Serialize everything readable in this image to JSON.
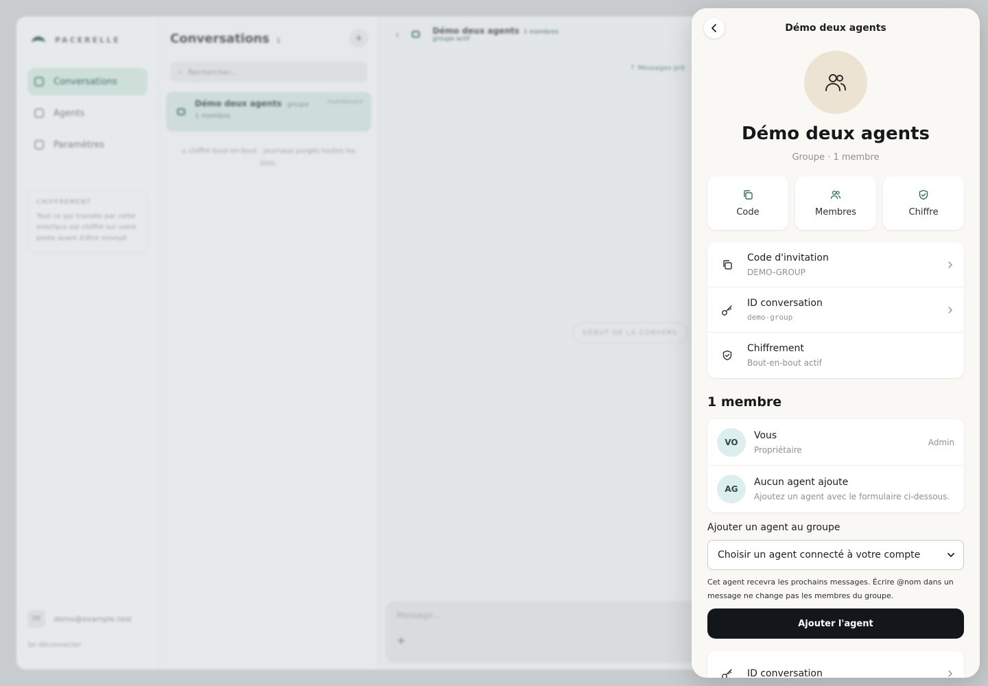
{
  "app": {
    "brand": "PACERELLE",
    "nav": [
      {
        "label": "Conversations",
        "active": true
      },
      {
        "label": "Agents",
        "active": false
      },
      {
        "label": "Paramètres",
        "active": false
      }
    ],
    "encryption_title": "CHIFFREMENT",
    "encryption_text": "Tout ce qui transite par cette interface est chiffré sur votre poste avant d'être envoyé.",
    "user_initials": "DE",
    "user_email": "demo@example.test",
    "logout": "Se déconnecter"
  },
  "conversations": {
    "title": "Conversations",
    "count": "1",
    "search_placeholder": "Rechercher...",
    "item": {
      "name": "Démo deux agents",
      "tag": "groupe",
      "time": "maintenant",
      "sub": "1 membre"
    },
    "note": "⌂ chiffré bout-en-bout · journaux purgés toutes les 2mn."
  },
  "chat": {
    "title": "Démo deux agents",
    "members_badge": "1 membres",
    "subtitle": "groupe actif",
    "older": "↑ Messages pré",
    "start": "DÉBUT DE LA CONVERS",
    "composer_placeholder": "Message...",
    "composer_plus": "+"
  },
  "panel": {
    "header_title": "Démo deux agents",
    "group_name": "Démo deux agents",
    "group_meta": "Groupe · 1 membre",
    "quick_actions": [
      {
        "label": "Code",
        "icon": "copy-icon"
      },
      {
        "label": "Membres",
        "icon": "users-icon"
      },
      {
        "label": "Chiffre",
        "icon": "shield-icon"
      }
    ],
    "info": {
      "invite_title": "Code d'invitation",
      "invite_value": "DEMO-GROUP",
      "conv_title": "ID conversation",
      "conv_value": "demo-group",
      "enc_title": "Chiffrement",
      "enc_value": "Bout-en-bout actif"
    },
    "members_title": "1 membre",
    "members": [
      {
        "initials": "VO",
        "name": "Vous",
        "sub": "Propriétaire",
        "role": "Admin"
      },
      {
        "initials": "AG",
        "name": "Aucun agent ajoute",
        "sub": "Ajoutez un agent avec le formulaire ci-dessous.",
        "role": ""
      }
    ],
    "add_label": "Ajouter un agent au groupe",
    "select_value": "Choisir un agent connecté à votre compte",
    "help": "Cet agent recevra les prochains messages. Écrire @nom dans un message ne change pas les membres du groupe.",
    "add_button": "Ajouter l'agent",
    "bottom_title": "ID conversation"
  },
  "colors": {
    "accent": "#3d6a62",
    "button": "#13171b",
    "avatar_bg": "#ede3d3",
    "member_av": "#dcefee"
  }
}
